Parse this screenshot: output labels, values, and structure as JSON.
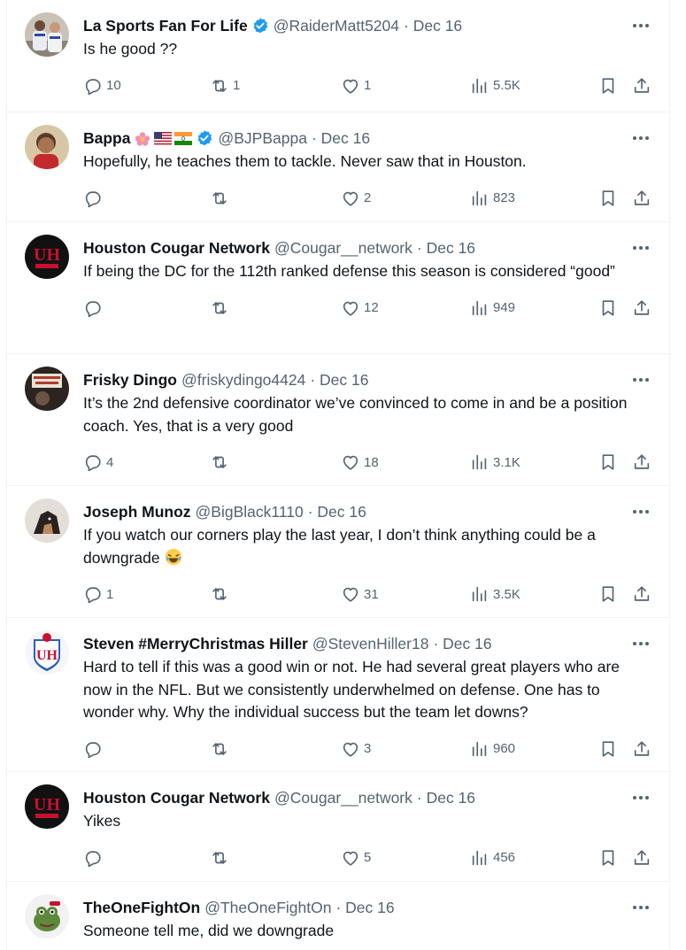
{
  "tweets": [
    {
      "name": "La Sports Fan For Life",
      "verified": true,
      "handle": "@RaiderMatt5204",
      "date": "· Dec 16",
      "text": "Is he good ??",
      "replies": "10",
      "retweets": "1",
      "likes": "1",
      "views": "5.5K",
      "avatar": "baseball-players-photo"
    },
    {
      "name": "Bappa",
      "flags": [
        "flower-emoji",
        "us-flag",
        "india-flag"
      ],
      "verified": true,
      "handle": "@BJPBappa",
      "date": "· Dec 16",
      "text": "Hopefully, he teaches them to tackle. Never saw that in Houston.",
      "replies": "",
      "retweets": "",
      "likes": "2",
      "views": "823",
      "avatar": "person-photo"
    },
    {
      "name": "Houston Cougar Network",
      "verified": false,
      "handle": "@Cougar__network",
      "date": "· Dec 16",
      "text": "If being the DC for the 112th ranked defense this season is considered “good”",
      "replies": "",
      "retweets": "",
      "likes": "12",
      "views": "949",
      "avatar": "uh-logo"
    },
    {
      "name": "Frisky Dingo",
      "verified": false,
      "handle": "@friskydingo4424",
      "date": "· Dec 16",
      "text": "It’s the 2nd defensive coordinator we’ve convinced to come in and be a position coach. Yes, that is a very good",
      "replies": "4",
      "retweets": "",
      "likes": "18",
      "views": "3.1K",
      "avatar": "positive-sign-photo"
    },
    {
      "name": "Joseph Munoz",
      "verified": false,
      "handle": "@BigBlack1110",
      "date": "· Dec 16",
      "text": "If you watch our corners play the last year, I don’t think anything could be a downgrade",
      "emoji": "laughing-crying-emoji",
      "replies": "1",
      "retweets": "",
      "likes": "31",
      "views": "3.5K",
      "avatar": "dog-photo"
    },
    {
      "name": "Steven #MerryChristmas Hiller",
      "verified": false,
      "handle": "@StevenHiller18",
      "date": "· Dec 16",
      "text": "Hard to tell if this was a good win or not. He had several great players who are now in the NFL. But we consistently underwhelmed on defense. One has to wonder why. Why the individual success but the team let downs?",
      "replies": "",
      "retweets": "",
      "likes": "3",
      "views": "960",
      "avatar": "uh-shield-logo"
    },
    {
      "name": "Houston Cougar Network",
      "verified": false,
      "handle": "@Cougar__network",
      "date": "· Dec 16",
      "text": "Yikes",
      "replies": "",
      "retweets": "",
      "likes": "5",
      "views": "456",
      "avatar": "uh-logo"
    },
    {
      "name": "TheOneFightOn",
      "verified": false,
      "handle": "@TheOneFightOn",
      "date": "· Dec 16",
      "text": "Someone tell me, did we downgrade",
      "replies": "",
      "retweets": "",
      "likes": "",
      "views": "",
      "avatar": "frog-cartoon"
    }
  ],
  "colors": {
    "text": "#0f1419",
    "muted": "#536471",
    "verified": "#1d9bf0",
    "border": "#eff3f4"
  },
  "icons": [
    "reply-icon",
    "retweet-icon",
    "like-icon",
    "views-icon",
    "bookmark-icon",
    "share-icon",
    "more-icon",
    "verified-badge-icon"
  ]
}
